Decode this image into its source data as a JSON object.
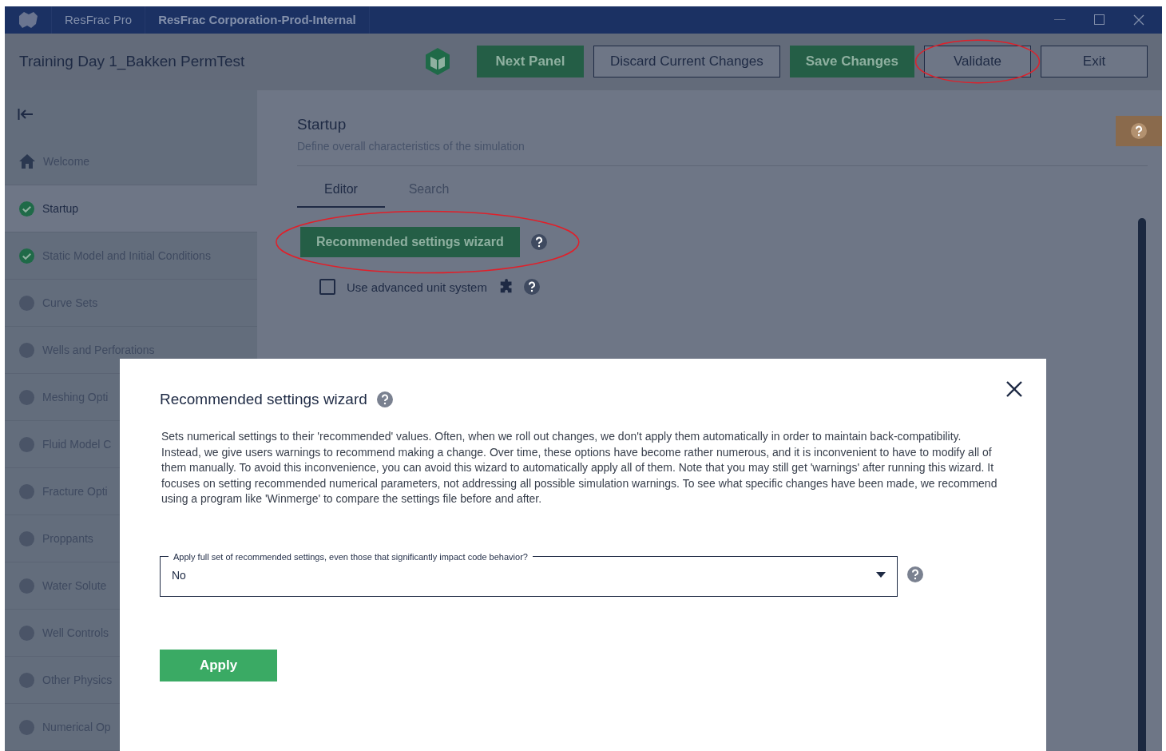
{
  "window": {
    "app_name": "ResFrac Pro",
    "title": "ResFrac Corporation-Prod-Internal"
  },
  "header": {
    "project": "Training Day 1_Bakken PermTest",
    "buttons": [
      {
        "label": "Next Panel",
        "kind": "primary",
        "circled": false
      },
      {
        "label": "Discard Current Changes",
        "kind": "outline",
        "circled": false
      },
      {
        "label": "Save Changes",
        "kind": "primary",
        "circled": false
      },
      {
        "label": "Validate",
        "kind": "outline",
        "circled": true
      },
      {
        "label": "Exit",
        "kind": "outline",
        "circled": false
      }
    ]
  },
  "sidebar": {
    "items": [
      {
        "label": "Welcome",
        "kind": "home",
        "selected": false
      },
      {
        "label": "Startup",
        "kind": "done",
        "selected": true
      },
      {
        "label": "Static Model and Initial Conditions",
        "kind": "done",
        "selected": false
      },
      {
        "label": "Curve Sets",
        "kind": "pending",
        "selected": false
      },
      {
        "label": "Wells and Perforations",
        "kind": "pending",
        "selected": false
      },
      {
        "label": "Meshing Opti",
        "kind": "pending",
        "selected": false
      },
      {
        "label": "Fluid Model C",
        "kind": "pending",
        "selected": false
      },
      {
        "label": "Fracture Opti",
        "kind": "pending",
        "selected": false
      },
      {
        "label": "Proppants",
        "kind": "pending",
        "selected": false
      },
      {
        "label": "Water Solute",
        "kind": "pending",
        "selected": false
      },
      {
        "label": "Well Controls",
        "kind": "pending",
        "selected": false
      },
      {
        "label": "Other Physics",
        "kind": "pending",
        "selected": false
      },
      {
        "label": "Numerical Op",
        "kind": "pending",
        "selected": false
      }
    ]
  },
  "page": {
    "title": "Startup",
    "subtitle": "Define overall characteristics of the simulation",
    "tabs": [
      {
        "label": "Editor",
        "selected": true
      },
      {
        "label": "Search",
        "selected": false
      }
    ],
    "wizard_button": {
      "label": "Recommended settings wizard",
      "circled": true
    },
    "advanced_units": {
      "label": "Use advanced unit system",
      "checked": false
    }
  },
  "dialog": {
    "title": "Recommended settings wizard",
    "body": "Sets numerical settings to their 'recommended' values. Often, when we roll out changes, we don't apply them automatically in order to maintain back-compatibility. Instead, we give users warnings to recommend making a change. Over time, these options have become rather numerous, and it is inconvenient to have to modify all of them manually. To avoid this inconvenience, you can avoid this wizard to automatically apply all of them. Note that you may still get 'warnings' after running this wizard. It focuses on setting recommended numerical parameters, not addressing all possible simulation warnings. To see what specific changes have been made, we recommend using a program like 'Winmerge' to compare the settings file before and after.",
    "select": {
      "label": "Apply full set of recommended settings, even those that significantly impact code behavior?",
      "value": "No"
    },
    "apply": "Apply"
  }
}
